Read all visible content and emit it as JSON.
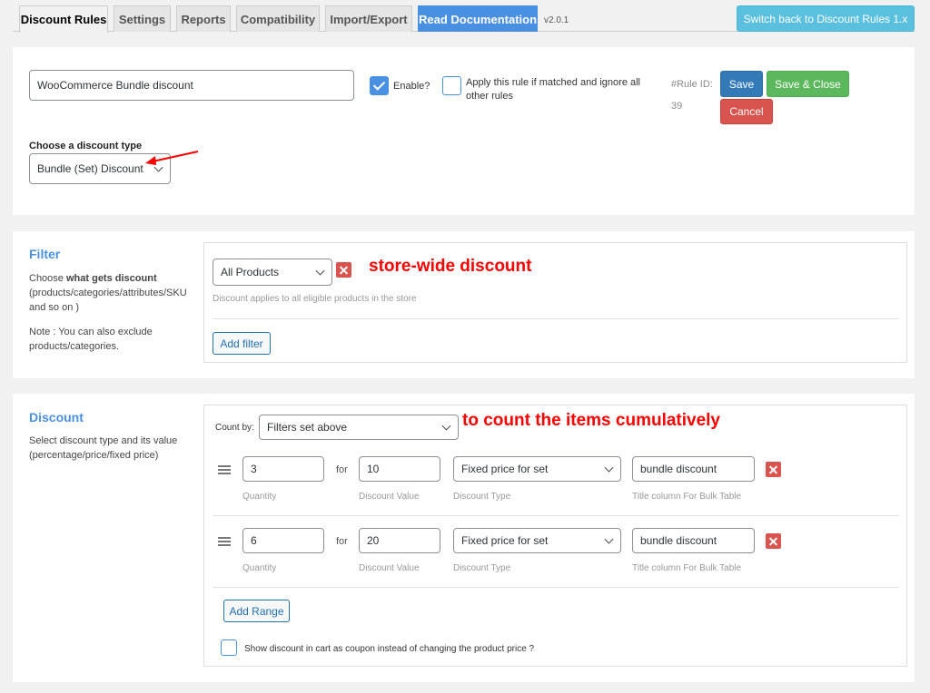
{
  "tabs": [
    {
      "label": "Discount Rules",
      "active": true
    },
    {
      "label": "Settings"
    },
    {
      "label": "Reports"
    },
    {
      "label": "Compatibility"
    },
    {
      "label": "Import/Export"
    },
    {
      "label": "Read Documentation"
    }
  ],
  "version": "v2.0.1",
  "switch_button": "Switch back to Discount Rules 1.x",
  "rule": {
    "name_value": "WooCommerce Bundle discount",
    "enable_label": "Enable?",
    "enable_checked": true,
    "apply_label": "Apply this rule if matched and ignore all other rules",
    "apply_checked": false,
    "rule_id_label": "#Rule ID:",
    "rule_id": "39",
    "save": "Save",
    "save_close": "Save & Close",
    "cancel": "Cancel",
    "discount_type_label": "Choose a discount type",
    "discount_type_value": "Bundle (Set) Discount"
  },
  "filter": {
    "title": "Filter",
    "desc_prefix": "Choose ",
    "desc_bold": "what gets discount",
    "desc_rest": "(products/categories/attributes/SKU and so on )",
    "note": "Note : You can also exclude products/categories.",
    "select_value": "All Products",
    "annotation": "store-wide discount",
    "help": "Discount applies to all eligible products in the store",
    "add_filter": "Add filter"
  },
  "discount": {
    "title": "Discount",
    "desc": "Select discount type and its value (percentage/price/fixed price)",
    "count_by_label": "Count by:",
    "count_by_value": "Filters set above",
    "annotation": "to count the items cumulatively",
    "ranges": [
      {
        "qty": "3",
        "for": "for",
        "value": "10",
        "type": "Fixed price for set",
        "title": "bundle discount"
      },
      {
        "qty": "6",
        "for": "for",
        "value": "20",
        "type": "Fixed price for set",
        "title": "bundle discount"
      }
    ],
    "hints": {
      "qty": "Quantity",
      "value": "Discount Value",
      "type": "Discount Type",
      "title": "Title column For Bulk Table"
    },
    "add_range": "Add Range",
    "coupon_label": "Show discount in cart as coupon instead of changing the product price ?",
    "coupon_checked": false
  },
  "colors": {
    "accent": "#4a90e2",
    "save": "#337ab7",
    "save_close": "#5cb85c",
    "cancel": "#d9534f",
    "annotation": "#ff0000"
  }
}
